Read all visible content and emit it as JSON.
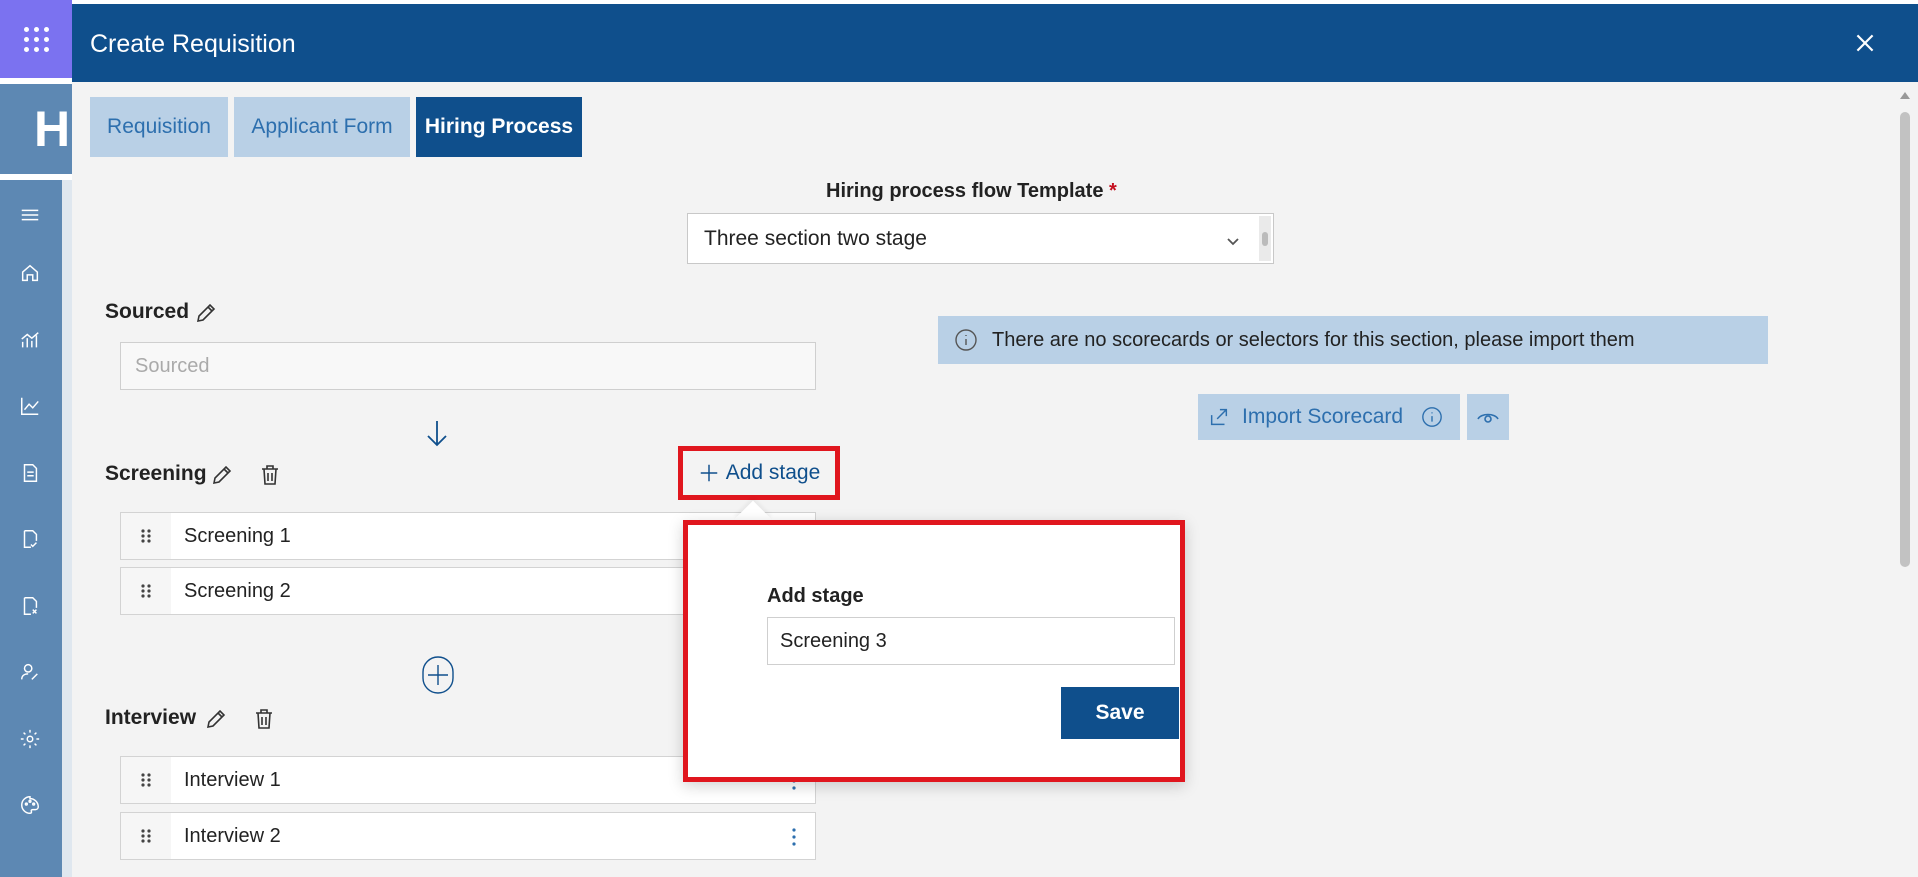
{
  "dialog": {
    "title": "Create Requisition"
  },
  "tabs": [
    {
      "label": "Requisition",
      "active": false
    },
    {
      "label": "Applicant Form",
      "active": false
    },
    {
      "label": "Hiring Process",
      "active": true
    }
  ],
  "background": {
    "brand_partial": "HI"
  },
  "template": {
    "label": "Hiring process flow Template",
    "required_mark": "*",
    "value": "Three section two stage"
  },
  "sections": {
    "sourced": {
      "label": "Sourced",
      "placeholder": "Sourced"
    },
    "screening": {
      "label": "Screening",
      "add_stage_label": "Add stage",
      "stages": [
        "Screening 1",
        "Screening 2"
      ]
    },
    "interview": {
      "label": "Interview",
      "stages": [
        "Interview 1",
        "Interview 2"
      ]
    }
  },
  "scorecard": {
    "info_text": "There are no scorecards or selectors for this section, please import them",
    "import_label": "Import Scorecard"
  },
  "popup": {
    "title": "Add stage",
    "input_value": "Screening 3",
    "save_label": "Save"
  },
  "colors": {
    "header": "#0f4f8c",
    "tab_inactive": "#b9d0e6",
    "rail": "#5d88b3",
    "waffle": "#7b72f0",
    "highlight": "#e0161e"
  }
}
